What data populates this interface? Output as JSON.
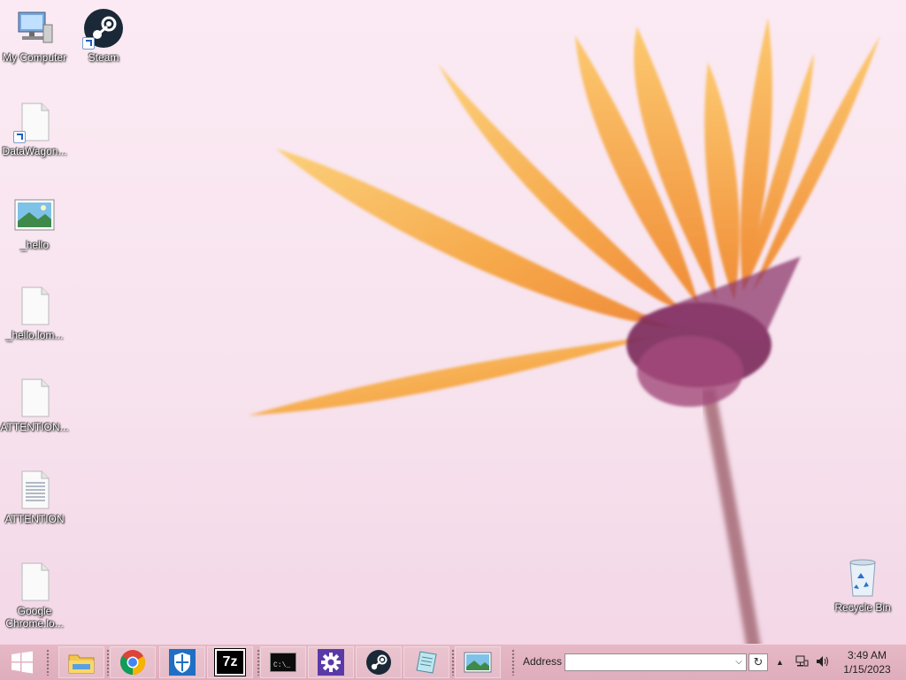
{
  "desktop": {
    "icons": [
      {
        "name": "My Computer"
      },
      {
        "name": "Steam"
      },
      {
        "name": "DataWagon..."
      },
      {
        "name": "_hello"
      },
      {
        "name": "_hello.lom..."
      },
      {
        "name": "ATTENTION..."
      },
      {
        "name": "ATTENTION"
      },
      {
        "name": "Google\nChrome.lo..."
      },
      {
        "name": "Recycle Bin"
      }
    ]
  },
  "taskbar": {
    "start": {
      "icon": "windows-logo-icon"
    },
    "pinned": [
      {
        "icon": "file-explorer-icon"
      },
      {
        "icon": "chrome-icon"
      },
      {
        "icon": "windows-defender-icon"
      },
      {
        "icon": "7zip-icon",
        "text": "7z"
      },
      {
        "icon": "command-prompt-icon",
        "text": "C:\\_"
      },
      {
        "icon": "settings-gear-icon"
      },
      {
        "icon": "steam-icon"
      },
      {
        "icon": "notepad-icon"
      },
      {
        "icon": "photos-icon"
      }
    ],
    "address": {
      "label": "Address",
      "value": ""
    },
    "tray": {
      "chevron": "▲",
      "network_icon": "network-icon",
      "volume_icon": "volume-icon"
    },
    "clock": {
      "time": "3:49 AM",
      "date": "1/15/2023"
    }
  },
  "colors": {
    "taskbar": "#e2b2c2",
    "petal": "#f6a64a",
    "flower_center": "#7a2a5a"
  }
}
